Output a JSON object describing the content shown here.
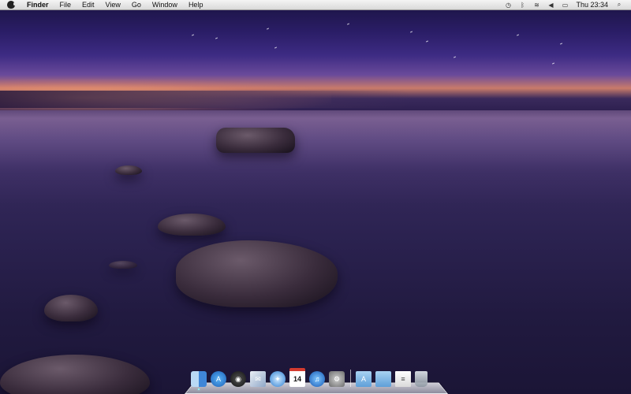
{
  "menubar": {
    "app_name": "Finder",
    "items": [
      "File",
      "Edit",
      "View",
      "Go",
      "Window",
      "Help"
    ],
    "status_icons": [
      "time-machine-icon",
      "bluetooth-icon",
      "wifi-icon",
      "volume-icon",
      "battery-icon"
    ],
    "clock": "Thu 23:34",
    "spotlight_icon": "spotlight-search-icon"
  },
  "dock": {
    "apps": [
      {
        "name": "Finder",
        "icon": "finder-icon",
        "running": true
      },
      {
        "name": "App Store",
        "icon": "app-store-icon",
        "running": false
      },
      {
        "name": "Dashboard",
        "icon": "dashboard-icon",
        "running": false
      },
      {
        "name": "Mail",
        "icon": "mail-icon",
        "running": false
      },
      {
        "name": "Safari",
        "icon": "safari-icon",
        "running": false
      },
      {
        "name": "iCal",
        "icon": "calendar-icon",
        "running": false,
        "label": "14"
      },
      {
        "name": "iTunes",
        "icon": "itunes-icon",
        "running": false
      },
      {
        "name": "System Preferences",
        "icon": "system-preferences-icon",
        "running": false
      }
    ],
    "stacks": [
      {
        "name": "Applications",
        "icon": "applications-folder-icon"
      },
      {
        "name": "Documents",
        "icon": "documents-folder-icon"
      },
      {
        "name": "Document",
        "icon": "document-icon"
      },
      {
        "name": "Trash",
        "icon": "trash-icon"
      }
    ]
  },
  "colors": {
    "menubar_bg": "#e6e6e6",
    "sky_top": "#1a1340",
    "horizon": "#c97b6a"
  }
}
